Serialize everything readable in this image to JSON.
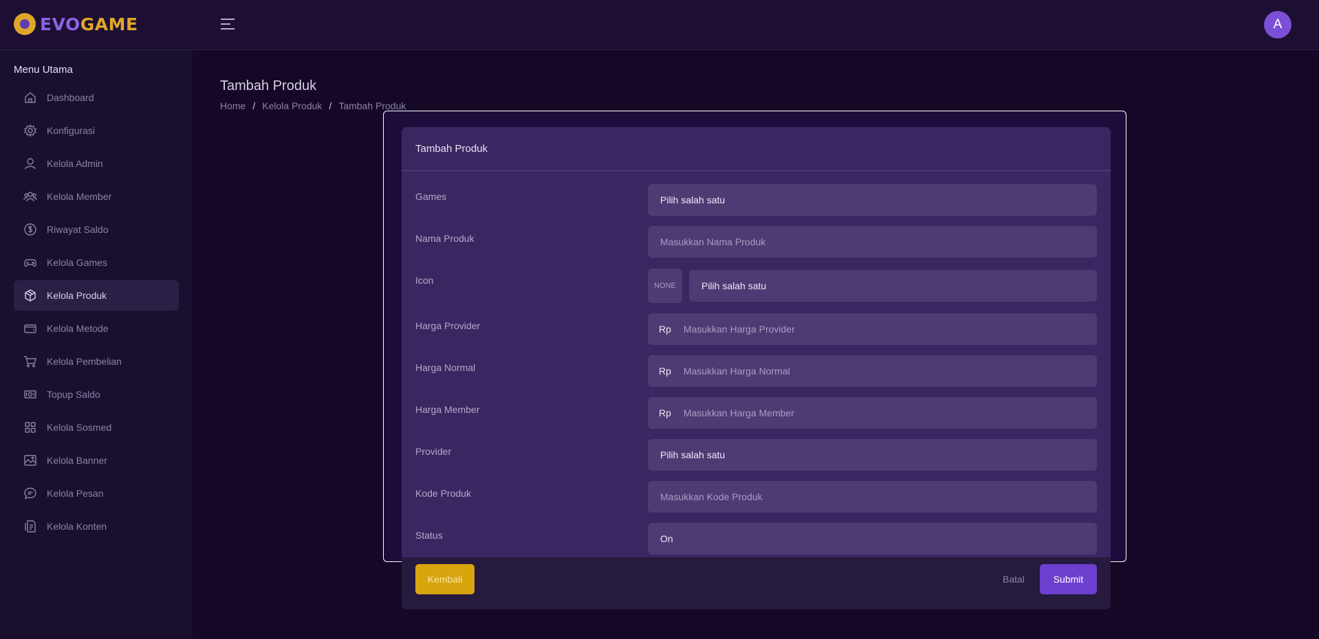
{
  "brand": {
    "part1": "EVO",
    "part2": "GAME"
  },
  "user": {
    "avatar_initial": "A"
  },
  "sidebar": {
    "title": "Menu Utama",
    "items": [
      {
        "label": "Dashboard",
        "icon": "home-icon"
      },
      {
        "label": "Konfigurasi",
        "icon": "gear-icon"
      },
      {
        "label": "Kelola Admin",
        "icon": "user-icon"
      },
      {
        "label": "Kelola Member",
        "icon": "users-icon"
      },
      {
        "label": "Riwayat Saldo",
        "icon": "dollar-circle-icon"
      },
      {
        "label": "Kelola Games",
        "icon": "gamepad-icon"
      },
      {
        "label": "Kelola Produk",
        "icon": "box-icon",
        "active": true
      },
      {
        "label": "Kelola Metode",
        "icon": "wallet-icon"
      },
      {
        "label": "Kelola Pembelian",
        "icon": "cart-icon"
      },
      {
        "label": "Topup Saldo",
        "icon": "cash-icon"
      },
      {
        "label": "Kelola Sosmed",
        "icon": "grid-icon"
      },
      {
        "label": "Kelola Banner",
        "icon": "image-icon"
      },
      {
        "label": "Kelola Pesan",
        "icon": "chat-icon"
      },
      {
        "label": "Kelola Konten",
        "icon": "document-icon"
      }
    ]
  },
  "page": {
    "title": "Tambah Produk",
    "breadcrumb": [
      "Home",
      "Kelola Produk",
      "Tambah Produk"
    ]
  },
  "form": {
    "title": "Tambah Produk",
    "games": {
      "label": "Games",
      "value": "Pilih salah satu"
    },
    "nama_produk": {
      "label": "Nama Produk",
      "placeholder": "Masukkan Nama Produk"
    },
    "icon": {
      "label": "Icon",
      "preview": "NONE",
      "value": "Pilih salah satu"
    },
    "harga_provider": {
      "label": "Harga Provider",
      "prefix": "Rp",
      "placeholder": "Masukkan Harga Provider"
    },
    "harga_normal": {
      "label": "Harga Normal",
      "prefix": "Rp",
      "placeholder": "Masukkan Harga Normal"
    },
    "harga_member": {
      "label": "Harga Member",
      "prefix": "Rp",
      "placeholder": "Masukkan Harga Member"
    },
    "provider": {
      "label": "Provider",
      "value": "Pilih salah satu"
    },
    "kode_produk": {
      "label": "Kode Produk",
      "placeholder": "Masukkan Kode Produk"
    },
    "status": {
      "label": "Status",
      "value": "On"
    }
  },
  "actions": {
    "back": "Kembali",
    "cancel": "Batal",
    "submit": "Submit"
  },
  "colors": {
    "accent": "#6d3fcf",
    "warning": "#d8a50e",
    "brand_gold": "#e0a52b"
  }
}
